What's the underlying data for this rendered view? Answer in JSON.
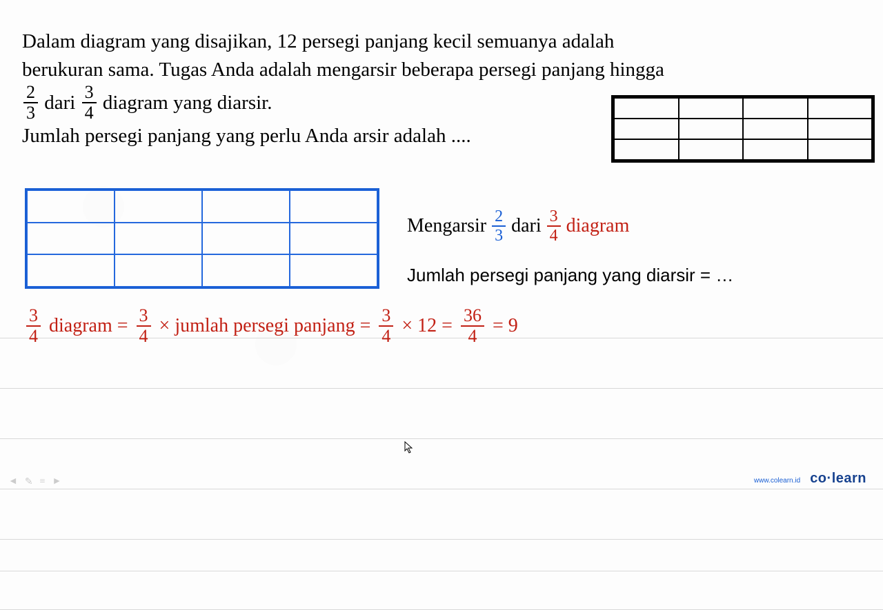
{
  "problem": {
    "line1": "Dalam diagram yang disajikan, 12 persegi panjang kecil semuanya adalah",
    "line2": "berukuran sama. Tugas Anda adalah mengarsir beberapa persegi panjang hingga",
    "frac1_num": "2",
    "frac1_den": "3",
    "dari": "dari",
    "frac2_num": "3",
    "frac2_den": "4",
    "line3_tail": "diagram yang diarsir.",
    "line4": "Jumlah persegi panjang yang perlu Anda arsir adalah ...."
  },
  "solution_right": {
    "mengarsir": "Mengarsir",
    "frac1_num": "2",
    "frac1_den": "3",
    "dari": "dari",
    "frac2_num": "3",
    "frac2_den": "4",
    "diagram": "diagram",
    "row2": "Jumlah persegi panjang yang diarsir = …"
  },
  "solution_bottom": {
    "frac1_num": "3",
    "frac1_den": "4",
    "text1": "diagram =",
    "frac2_num": "3",
    "frac2_den": "4",
    "text2": "× jumlah persegi panjang  =",
    "frac3_num": "3",
    "frac3_den": "4",
    "text3": "× 12  =",
    "frac4_num": "36",
    "frac4_den": "4",
    "text4": "= 9"
  },
  "footer": {
    "url": "www.colearn.id",
    "logo": "co·learn"
  },
  "grid_black": {
    "rows": 3,
    "cols": 4
  },
  "grid_blue": {
    "rows": 3,
    "cols": 4
  },
  "colors": {
    "red": "#c22014",
    "blue": "#1a5fd4",
    "black": "#000000"
  },
  "chart_data": [
    {
      "type": "table",
      "name": "black-grid",
      "rows": 3,
      "cols": 4,
      "total_cells": 12,
      "border_color": "#000000"
    },
    {
      "type": "table",
      "name": "blue-grid",
      "rows": 3,
      "cols": 4,
      "total_cells": 12,
      "border_color": "#1a5fd4"
    }
  ]
}
